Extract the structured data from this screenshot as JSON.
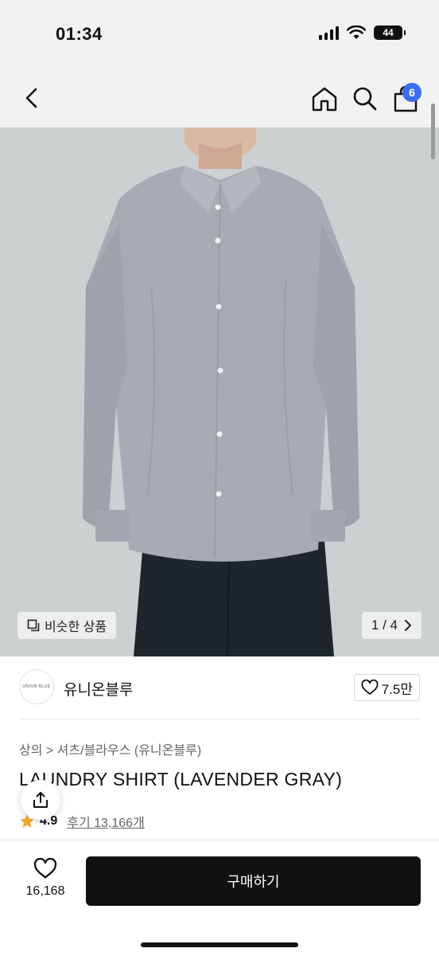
{
  "status_bar": {
    "time": "01:34",
    "battery": "44"
  },
  "header": {
    "cart_count": "6",
    "icons": [
      "back-icon",
      "home-icon",
      "search-icon",
      "shopping-bag-icon"
    ]
  },
  "hero": {
    "similar_label": "비슷한 상품",
    "pager": "1 / 4",
    "colors": {
      "shirt": "#a7abb3",
      "background": "#cdd0d1",
      "pants": "#1e252b"
    }
  },
  "brand": {
    "logo_text": "UNION BLUE",
    "name": "유니온블루",
    "likes": "7.5만"
  },
  "product": {
    "category": "상의 > 셔츠/블라우스 (유니온블루)",
    "title": "LAUNDRY SHIRT (LAVENDER GRAY)",
    "rating": "4.9",
    "reviews": "후기 13,166개"
  },
  "bottom_bar": {
    "like_count": "16,168",
    "buy_label": "구매하기"
  }
}
